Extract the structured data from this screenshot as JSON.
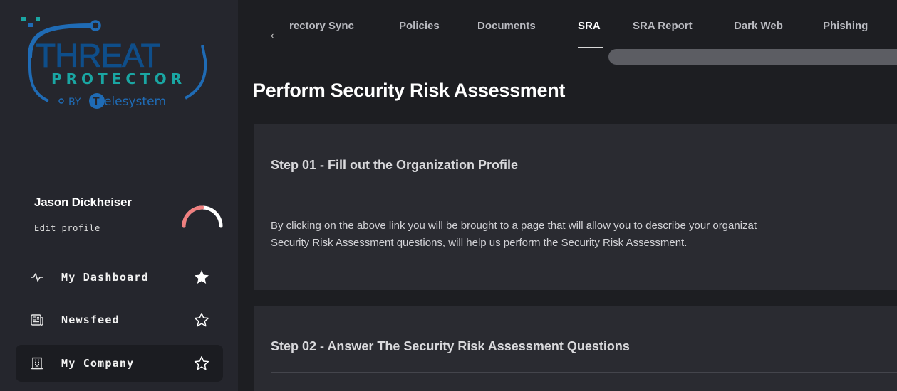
{
  "brand": {
    "line1": "THREAT",
    "line2": "PROTECTOR",
    "line3_prefix": "BY",
    "line3_name": "elesystem",
    "colors": {
      "blue": "#1f6bb5",
      "teal": "#1aa6a3",
      "wordmark": "#0f4e8a"
    }
  },
  "profile": {
    "name": "Jason Dickheiser",
    "edit_label": "Edit profile",
    "gauge_color": "#f07f7f"
  },
  "nav": [
    {
      "label": "My Dashboard",
      "icon": "pulse-icon",
      "favorite": true
    },
    {
      "label": "Newsfeed",
      "icon": "newspaper-icon",
      "favorite": false
    },
    {
      "label": "My Company",
      "icon": "building-icon",
      "favorite": false,
      "active": true
    }
  ],
  "tabs": {
    "prev_glyph": "‹",
    "items": [
      "rectory Sync",
      "Policies",
      "Documents",
      "SRA",
      "SRA Report",
      "Dark Web",
      "Phishing"
    ],
    "active": "SRA"
  },
  "page": {
    "title": "Perform Security Risk Assessment"
  },
  "steps": [
    {
      "title": "Step 01 - Fill out the Organization Profile",
      "body_line1": "By clicking on the above link you will be brought to a page that will allow you to describe your organizat",
      "body_line2": "Security Risk Assessment questions, will help us perform the Security Risk Assessment."
    },
    {
      "title": "Step 02 - Answer The Security Risk Assessment Questions"
    }
  ]
}
